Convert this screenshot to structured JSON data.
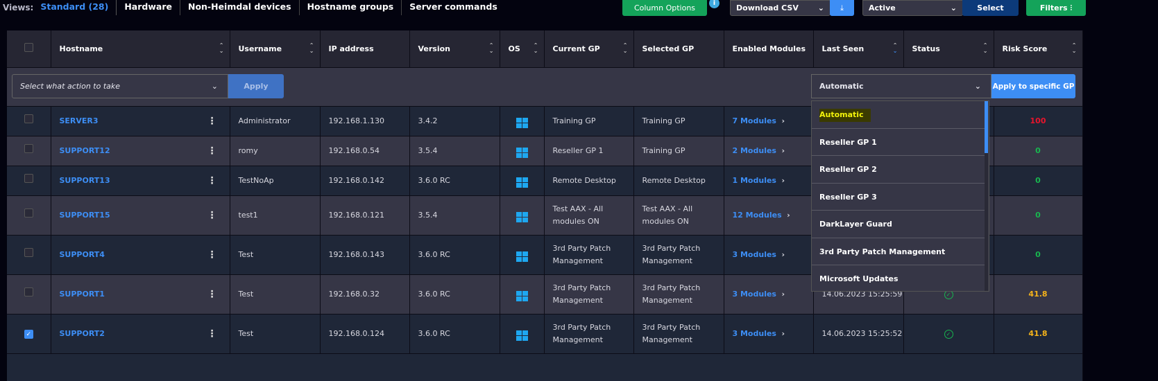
{
  "views": {
    "label": "Views:",
    "items": [
      "Standard (28)",
      "Hardware",
      "Non-Heimdal devices",
      "Hostname groups",
      "Server commands"
    ]
  },
  "toolbar": {
    "column_options": "Column Options",
    "download": "Download CSV",
    "status_filter": "Active",
    "select": "Select",
    "filters": "Filters"
  },
  "columns": [
    "Hostname",
    "Username",
    "IP address",
    "Version",
    "OS",
    "Current GP",
    "Selected GP",
    "Enabled Modules",
    "Last Seen",
    "Status",
    "Risk Score"
  ],
  "actions": {
    "placeholder": "Select what action to take",
    "apply": "Apply",
    "gp_value": "Automatic",
    "apply_gp": "Apply to specific GP"
  },
  "dropdown": [
    "Automatic",
    "Reseller GP 1",
    "Reseller GP 2",
    "Reseller GP 3",
    "DarkLayer Guard",
    "3rd Party Patch Management",
    "Microsoft Updates"
  ],
  "rows": [
    {
      "host": "SERVER3",
      "user": "Administrator",
      "ip": "192.168.1.130",
      "ver": "3.4.2",
      "cur": "Training GP",
      "selgp": "Training GP",
      "mods": "7 Modules",
      "seen": "",
      "risk": "100",
      "risk_color": "#e8142c",
      "checked": false
    },
    {
      "host": "SUPPORT12",
      "user": "romy",
      "ip": "192.168.0.54",
      "ver": "3.5.4",
      "cur": "Reseller GP 1",
      "selgp": "Training GP",
      "mods": "2 Modules",
      "seen": "",
      "risk": "0",
      "risk_color": "#18b54f",
      "checked": false
    },
    {
      "host": "SUPPORT13",
      "user": "TestNoAp",
      "ip": "192.168.0.142",
      "ver": "3.6.0 RC",
      "cur": "Remote Desktop",
      "selgp": "Remote Desktop",
      "mods": "1 Modules",
      "seen": "",
      "risk": "0",
      "risk_color": "#18b54f",
      "checked": false
    },
    {
      "host": "SUPPORT15",
      "user": "test1",
      "ip": "192.168.0.121",
      "ver": "3.5.4",
      "cur": "Test AAX - All modules ON",
      "selgp": "Test AAX - All modules ON",
      "mods": "12 Modules",
      "seen": "",
      "risk": "0",
      "risk_color": "#18b54f",
      "checked": false
    },
    {
      "host": "SUPPORT4",
      "user": "Test",
      "ip": "192.168.0.143",
      "ver": "3.6.0 RC",
      "cur": "3rd Party Patch Management",
      "selgp": "3rd Party Patch Management",
      "mods": "3 Modules",
      "seen": "",
      "risk": "0",
      "risk_color": "#18b54f",
      "checked": false
    },
    {
      "host": "SUPPORT1",
      "user": "Test",
      "ip": "192.168.0.32",
      "ver": "3.6.0 RC",
      "cur": "3rd Party Patch Management",
      "selgp": "3rd Party Patch Management",
      "mods": "3 Modules",
      "seen": "14.06.2023  15:25:59",
      "risk": "41.8",
      "risk_color": "#f5b31a",
      "checked": false
    },
    {
      "host": "SUPPORT2",
      "user": "Test",
      "ip": "192.168.0.124",
      "ver": "3.6.0 RC",
      "cur": "3rd Party Patch Management",
      "selgp": "3rd Party Patch Management",
      "mods": "3 Modules",
      "seen": "14.06.2023  15:25:52",
      "risk": "41.8",
      "risk_color": "#f5b31a",
      "checked": true
    }
  ]
}
